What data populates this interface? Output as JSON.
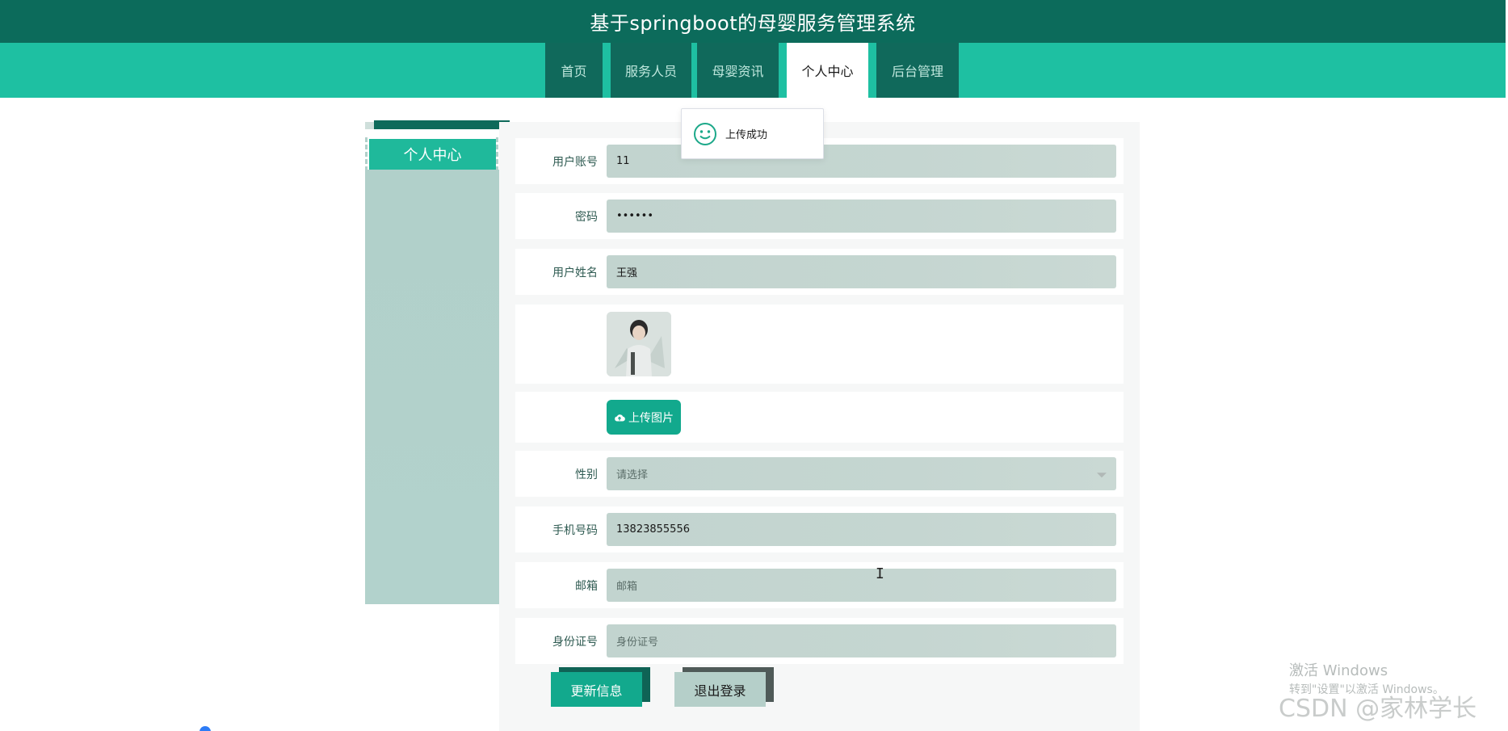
{
  "header": {
    "title": "基于springboot的母婴服务管理系统"
  },
  "nav": {
    "items": [
      {
        "label": "首页"
      },
      {
        "label": "服务人员"
      },
      {
        "label": "母婴资讯"
      },
      {
        "label": "个人中心",
        "active": true
      },
      {
        "label": "后台管理"
      }
    ]
  },
  "sidebar": {
    "active_label": "个人中心"
  },
  "toast": {
    "message": "上传成功",
    "icon": "smile-icon"
  },
  "form": {
    "account_label": "用户账号",
    "account_value": "11",
    "password_label": "密码",
    "password_value": "••••••",
    "name_label": "用户姓名",
    "name_value": "王强",
    "upload_label": "上传图片",
    "gender_label": "性别",
    "gender_placeholder": "请选择",
    "phone_label": "手机号码",
    "phone_value": "13823855556",
    "email_label": "邮箱",
    "email_placeholder": "邮箱",
    "idcard_label": "身份证号",
    "idcard_placeholder": "身份证号"
  },
  "actions": {
    "update_label": "更新信息",
    "logout_label": "退出登录"
  },
  "watermark": {
    "activate_title": "激活 Windows",
    "activate_sub": "转到\"设置\"以激活 Windows。",
    "csdn": "CSDN @家林学长"
  },
  "colors": {
    "header_bg": "#0c6b5b",
    "nav_bg": "#1ec0a2",
    "nav_item_bg": "#10695b",
    "accent": "#12a98d",
    "field_bg": "#c2d4cf"
  }
}
